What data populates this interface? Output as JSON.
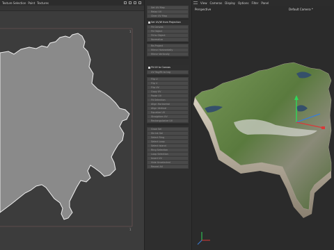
{
  "uv_editor": {
    "menu": [
      "Texture Selection",
      "Paint",
      "Textures"
    ],
    "menu_icon_names": [
      "move-icon",
      "zoom-icon",
      "frame-icon",
      "maximize-icon"
    ]
  },
  "tools": {
    "group1": [
      "Set UV Map",
      "Relax UV",
      "Clear UV Map"
    ],
    "active_tool": "Set UV/W from Projection",
    "group2": [
      "Fit Canvas",
      "Fit Object",
      "Fit to Object",
      "Normalize"
    ],
    "group3": [
      "Re-Project",
      "Mirror Horizontally",
      "Mirror Vertically"
    ],
    "uv_tag_tool": "Fit UV to Canvas",
    "uv_tag_sub": "UV Tag/Fit to tag",
    "group4": [
      "Flip U",
      "Flip V",
      "Flip UV",
      "Copy UV",
      "Paste UV",
      "Fit Selection",
      "Align Horizontal",
      "Align Vertical",
      "Equalize UV",
      "Straighten UV",
      "Rectangularize UV"
    ],
    "group5": [
      "Grow Sel",
      "Shrink Sel",
      "Select Ring",
      "Select Loop",
      "Select Island",
      "Ring Selection",
      "Loop Selection",
      "Invert UV",
      "Hide Unselected",
      "Reveal All"
    ]
  },
  "viewport": {
    "menu": [
      "View",
      "Cameras",
      "Display",
      "Options",
      "Filter",
      "Panel"
    ],
    "view_name": "Perspective",
    "camera_name": "Default Camera",
    "camera_marker": "*"
  },
  "colors": {
    "uv_island": "#8a8a8a",
    "uv_outline": "#e6e6e6",
    "uv_bounds": "#b07a7a",
    "terrain_green": "#6b8a4a",
    "gizmo_green": "#2fd85a",
    "gizmo_blue": "#3a7dd8",
    "gizmo_red": "#d83a3a"
  }
}
